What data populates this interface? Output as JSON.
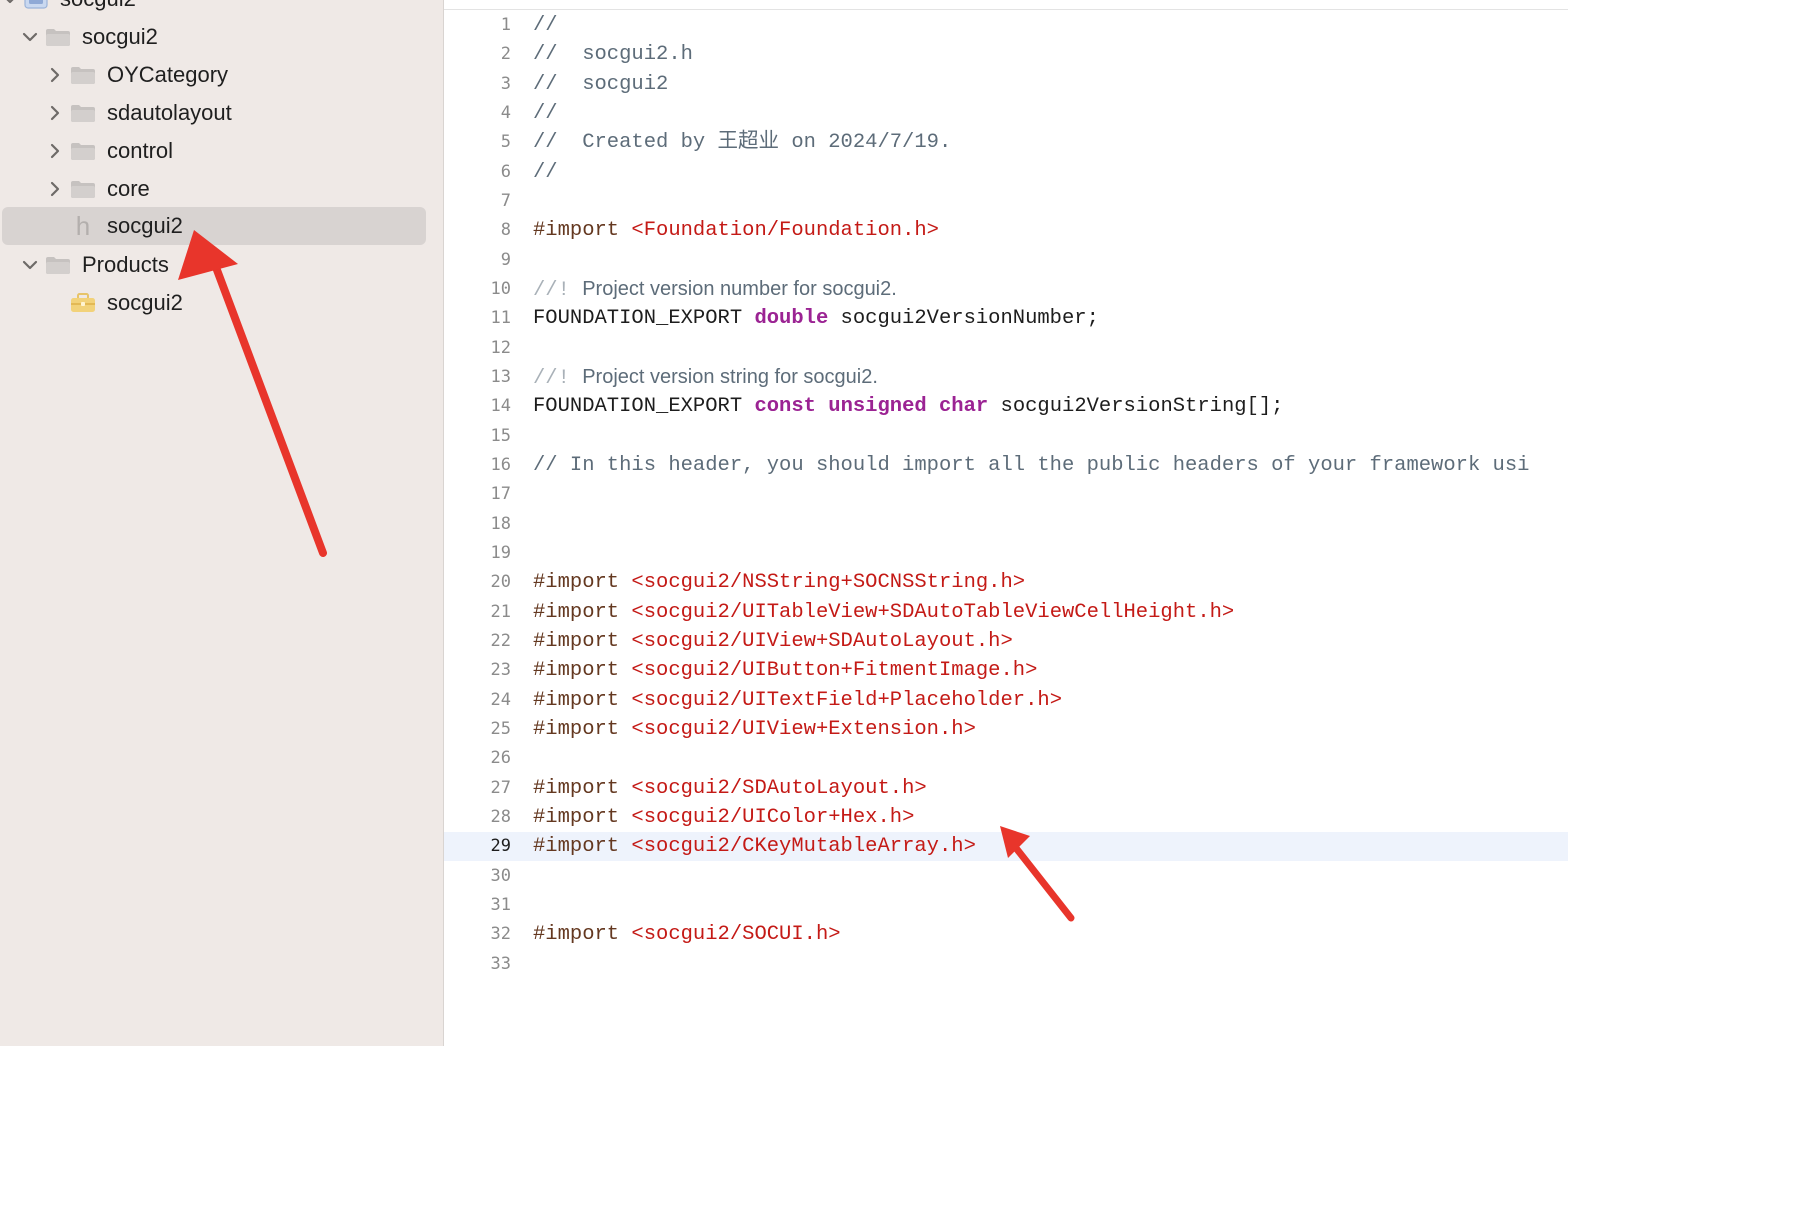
{
  "navigator": {
    "project_name": "socgui2",
    "group_name": "socgui2",
    "folders": [
      "OYCategory",
      "sdautolayout",
      "control",
      "core"
    ],
    "header_file": "socgui2",
    "header_glyph": "h",
    "products_group": "Products",
    "product": "socgui2"
  },
  "editor": {
    "current_line": 29,
    "lines": [
      {
        "n": "1",
        "segs": [
          {
            "c": "cm",
            "t": "//"
          }
        ]
      },
      {
        "n": "2",
        "segs": [
          {
            "c": "cm",
            "t": "//  socgui2.h"
          }
        ]
      },
      {
        "n": "3",
        "segs": [
          {
            "c": "cm",
            "t": "//  socgui2"
          }
        ]
      },
      {
        "n": "4",
        "segs": [
          {
            "c": "cm",
            "t": "//"
          }
        ]
      },
      {
        "n": "5",
        "segs": [
          {
            "c": "cm",
            "t": "//  Created by 王超业 on 2024/7/19."
          }
        ]
      },
      {
        "n": "6",
        "segs": [
          {
            "c": "cm",
            "t": "//"
          }
        ]
      },
      {
        "n": "7",
        "segs": []
      },
      {
        "n": "8",
        "segs": [
          {
            "c": "pp",
            "t": "#import "
          },
          {
            "c": "str",
            "t": "<Foundation/Foundation.h>"
          }
        ]
      },
      {
        "n": "9",
        "segs": []
      },
      {
        "n": "10",
        "segs": [
          {
            "c": "docmark",
            "t": "//! "
          },
          {
            "c": "doc",
            "t": "Project version number for socgui2."
          }
        ]
      },
      {
        "n": "11",
        "segs": [
          {
            "c": "",
            "t": "FOUNDATION_EXPORT "
          },
          {
            "c": "kw",
            "t": "double"
          },
          {
            "c": "",
            "t": " socgui2VersionNumber;"
          }
        ]
      },
      {
        "n": "12",
        "segs": []
      },
      {
        "n": "13",
        "segs": [
          {
            "c": "docmark",
            "t": "//! "
          },
          {
            "c": "doc",
            "t": "Project version string for socgui2."
          }
        ]
      },
      {
        "n": "14",
        "segs": [
          {
            "c": "",
            "t": "FOUNDATION_EXPORT "
          },
          {
            "c": "kw",
            "t": "const"
          },
          {
            "c": "",
            "t": " "
          },
          {
            "c": "kw",
            "t": "unsigned"
          },
          {
            "c": "",
            "t": " "
          },
          {
            "c": "kw",
            "t": "char"
          },
          {
            "c": "",
            "t": " socgui2VersionString[];"
          }
        ]
      },
      {
        "n": "15",
        "segs": []
      },
      {
        "n": "16",
        "segs": [
          {
            "c": "cm",
            "t": "// In this header, you should import all the public headers of your framework usi"
          }
        ]
      },
      {
        "n": "17",
        "segs": []
      },
      {
        "n": "18",
        "segs": []
      },
      {
        "n": "19",
        "segs": []
      },
      {
        "n": "20",
        "segs": [
          {
            "c": "pp",
            "t": "#import "
          },
          {
            "c": "str",
            "t": "<socgui2/NSString+SOCNSString.h>"
          }
        ]
      },
      {
        "n": "21",
        "segs": [
          {
            "c": "pp",
            "t": "#import "
          },
          {
            "c": "str",
            "t": "<socgui2/UITableView+SDAutoTableViewCellHeight.h>"
          }
        ]
      },
      {
        "n": "22",
        "segs": [
          {
            "c": "pp",
            "t": "#import "
          },
          {
            "c": "str",
            "t": "<socgui2/UIView+SDAutoLayout.h>"
          }
        ]
      },
      {
        "n": "23",
        "segs": [
          {
            "c": "pp",
            "t": "#import "
          },
          {
            "c": "str",
            "t": "<socgui2/UIButton+FitmentImage.h>"
          }
        ]
      },
      {
        "n": "24",
        "segs": [
          {
            "c": "pp",
            "t": "#import "
          },
          {
            "c": "str",
            "t": "<socgui2/UITextField+Placeholder.h>"
          }
        ]
      },
      {
        "n": "25",
        "segs": [
          {
            "c": "pp",
            "t": "#import "
          },
          {
            "c": "str",
            "t": "<socgui2/UIView+Extension.h>"
          }
        ]
      },
      {
        "n": "26",
        "segs": []
      },
      {
        "n": "27",
        "segs": [
          {
            "c": "pp",
            "t": "#import "
          },
          {
            "c": "str",
            "t": "<socgui2/SDAutoLayout.h>"
          }
        ]
      },
      {
        "n": "28",
        "segs": [
          {
            "c": "pp",
            "t": "#import "
          },
          {
            "c": "str",
            "t": "<socgui2/UIColor+Hex.h>"
          }
        ]
      },
      {
        "n": "29",
        "segs": [
          {
            "c": "pp",
            "t": "#import "
          },
          {
            "c": "str",
            "t": "<socgui2/CKeyMutableArray.h>"
          }
        ]
      },
      {
        "n": "30",
        "segs": []
      },
      {
        "n": "31",
        "segs": []
      },
      {
        "n": "32",
        "segs": [
          {
            "c": "pp",
            "t": "#import "
          },
          {
            "c": "str",
            "t": "<socgui2/SOCUI.h>"
          }
        ]
      },
      {
        "n": "33",
        "segs": []
      }
    ]
  },
  "colors": {
    "sidebar_bg": "#efe9e6",
    "selection_bg": "#d8d3d1",
    "current_line_bg": "#eef3fc",
    "comment": "#5d6c79",
    "preprocessor": "#643820",
    "string": "#c41a16",
    "keyword": "#9b2393",
    "annotation_arrow": "#e8352b"
  },
  "icons": {
    "folder": "folder-icon",
    "header": "header-file-icon",
    "product": "framework-icon",
    "project": "project-icon",
    "disclosure_open": "chevron-down-icon",
    "disclosure_closed": "chevron-right-icon"
  }
}
